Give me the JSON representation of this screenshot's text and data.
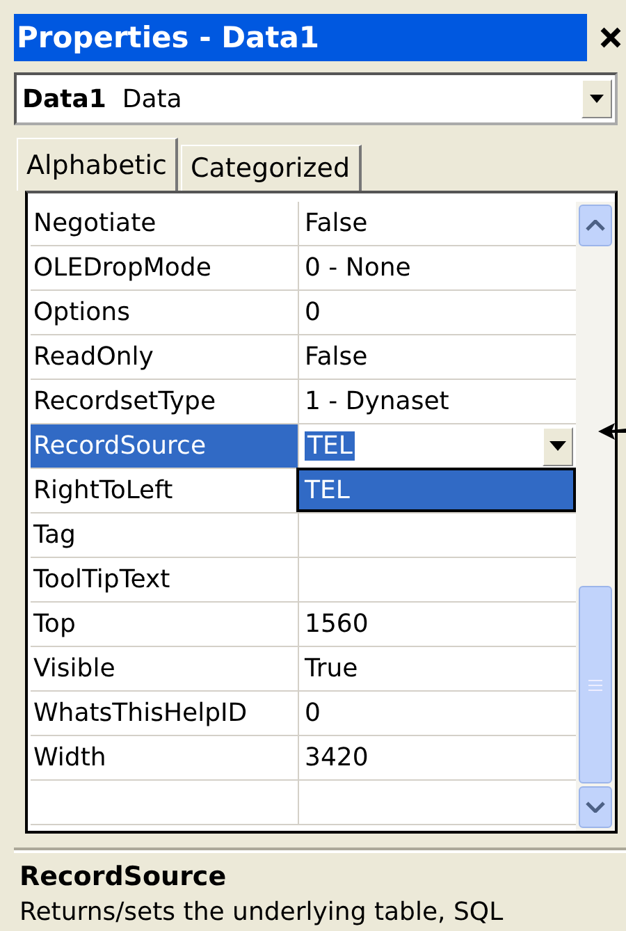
{
  "window": {
    "title": "Properties - Data1"
  },
  "object_selector": {
    "name": "Data1",
    "type": "Data"
  },
  "tabs": [
    {
      "label": "Alphabetic",
      "selected": true
    },
    {
      "label": "Categorized",
      "selected": false
    }
  ],
  "properties": [
    {
      "name": "Negotiate",
      "value": "False",
      "selected": false
    },
    {
      "name": "OLEDropMode",
      "value": "0 - None",
      "selected": false
    },
    {
      "name": "Options",
      "value": "0",
      "selected": false
    },
    {
      "name": "ReadOnly",
      "value": "False",
      "selected": false
    },
    {
      "name": "RecordsetType",
      "value": "1 - Dynaset",
      "selected": false
    },
    {
      "name": "RecordSource",
      "value": "TEL",
      "selected": true,
      "dropdown": [
        {
          "label": "TEL",
          "selected": true
        }
      ]
    },
    {
      "name": "RightToLeft",
      "selected": false
    },
    {
      "name": "Tag",
      "selected": false
    },
    {
      "name": "ToolTipText",
      "selected": false
    },
    {
      "name": "Top",
      "value": "1560",
      "selected": false
    },
    {
      "name": "Visible",
      "value": "True",
      "selected": false
    },
    {
      "name": "WhatsThisHelpID",
      "value": "0",
      "selected": false
    },
    {
      "name": "Width",
      "value": "3420",
      "selected": false
    }
  ],
  "description": {
    "title": "RecordSource",
    "text": "Returns/sets the underlying table, SQL"
  }
}
